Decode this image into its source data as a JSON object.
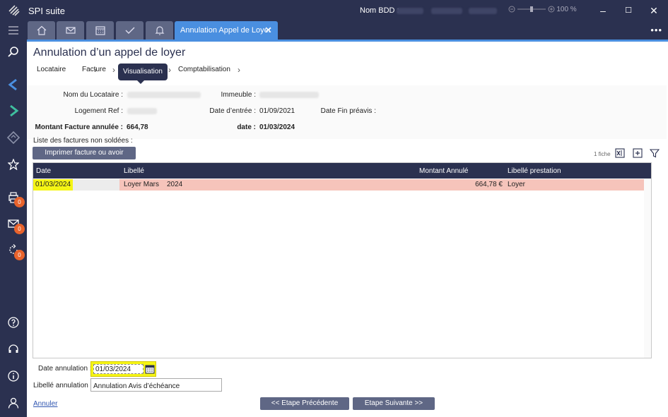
{
  "app": {
    "title": "SPI suite",
    "bdd_label": "Nom BDD :",
    "zoom_level": "100 %"
  },
  "tabs": {
    "icons": [
      "home-icon",
      "mail-icon",
      "calendar-icon",
      "check-icon",
      "bell-icon"
    ],
    "active_label": "Annulation Appel de Loyer"
  },
  "sidebar": {
    "badges": [
      "0",
      "0",
      "0"
    ]
  },
  "page": {
    "title": "Annulation d’un appel de loyer"
  },
  "steps": [
    "Locataire",
    "Facture",
    "Visualisation",
    "Comptabilisation"
  ],
  "form": {
    "nom_locataire_label": "Nom du Locataire :",
    "immeuble_label": "Immeuble :",
    "logement_ref_label": "Logement Ref :",
    "date_entree_label": "Date d’entrée :",
    "date_entree_value": "01/09/2021",
    "date_fin_preavis_label": "Date Fin préavis :",
    "montant_label": "Montant Facture annulée :",
    "montant_value": "664,78",
    "date_label": "date :",
    "date_value": "01/03/2024"
  },
  "list": {
    "title": "Liste des factures non soldées :",
    "print_button": "Imprimer facture ou avoir",
    "count": "1 fiche",
    "columns": [
      "Date",
      "Libellé",
      "Montant Annulé",
      "Libellé prestation"
    ],
    "rows": [
      {
        "date": "01/03/2024",
        "libelle": "Loyer Mars",
        "libelle_year": "2024",
        "montant": "664,78 €",
        "prestation": "Loyer"
      }
    ]
  },
  "annulation": {
    "date_label": "Date annulation :",
    "date_value": "01/03/2024",
    "libelle_label": "Libellé annulation :",
    "libelle_value": "Annulation Avis d’échéance"
  },
  "footer": {
    "annuler": "Annuler",
    "prev_button": "<< Etape Précédente",
    "next_button": "Etape Suivante >>"
  },
  "colors": {
    "navy": "#2b3150",
    "accent": "#4a8fe0",
    "row_highlight": "#f6c4bb",
    "yellow_highlight": "#f5f515",
    "badge": "#e8632c"
  }
}
